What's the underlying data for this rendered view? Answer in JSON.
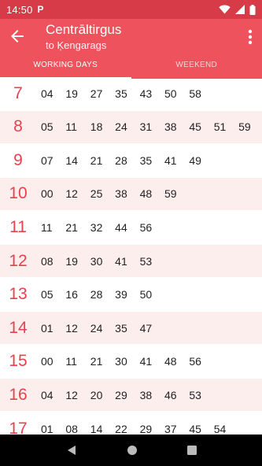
{
  "status": {
    "time": "14:50",
    "notification_letter": "P"
  },
  "header": {
    "title": "Centrāltirgus",
    "subtitle": "to Ķengarags"
  },
  "tabs": [
    {
      "label": "WORKING DAYS",
      "active": true
    },
    {
      "label": "WEEKEND",
      "active": false
    }
  ],
  "schedule": [
    {
      "hour": "7",
      "minutes": [
        "04",
        "19",
        "27",
        "35",
        "43",
        "50",
        "58"
      ]
    },
    {
      "hour": "8",
      "minutes": [
        "05",
        "11",
        "18",
        "24",
        "31",
        "38",
        "45",
        "51",
        "59"
      ]
    },
    {
      "hour": "9",
      "minutes": [
        "07",
        "14",
        "21",
        "28",
        "35",
        "41",
        "49"
      ]
    },
    {
      "hour": "10",
      "minutes": [
        "00",
        "12",
        "25",
        "38",
        "48",
        "59"
      ]
    },
    {
      "hour": "11",
      "minutes": [
        "11",
        "21",
        "32",
        "44",
        "56"
      ]
    },
    {
      "hour": "12",
      "minutes": [
        "08",
        "19",
        "30",
        "41",
        "53"
      ]
    },
    {
      "hour": "13",
      "minutes": [
        "05",
        "16",
        "28",
        "39",
        "50"
      ]
    },
    {
      "hour": "14",
      "minutes": [
        "01",
        "12",
        "24",
        "35",
        "47"
      ]
    },
    {
      "hour": "15",
      "minutes": [
        "00",
        "11",
        "21",
        "30",
        "41",
        "48",
        "56"
      ]
    },
    {
      "hour": "16",
      "minutes": [
        "04",
        "12",
        "20",
        "29",
        "38",
        "46",
        "53"
      ]
    },
    {
      "hour": "17",
      "minutes": [
        "01",
        "08",
        "14",
        "22",
        "29",
        "37",
        "45",
        "54"
      ]
    }
  ],
  "colors": {
    "status_bar": "#d63b47",
    "app_bar": "#ee525d",
    "hour_text": "#e8404f",
    "alt_row": "#fdeeee"
  },
  "icons": {
    "back": "arrow-left-icon",
    "menu": "more-vert-icon",
    "wifi": "wifi-icon",
    "signal": "signal-icon",
    "battery": "battery-icon"
  }
}
